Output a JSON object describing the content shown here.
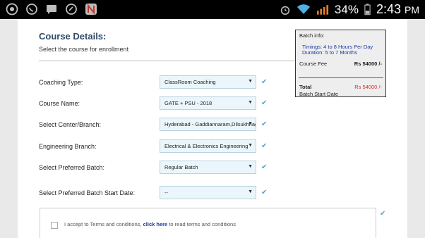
{
  "status_bar": {
    "icons_left": [
      "chrome-icon",
      "whatsapp-icon",
      "message-icon",
      "phone-icon",
      "netflix-icon"
    ],
    "battery": "34%",
    "time": "2:43",
    "time_suffix": "PM"
  },
  "course": {
    "title": "Course Details:",
    "subtitle": "Select the course for enrollment"
  },
  "batch_info": {
    "title": "Batch info:",
    "timings": "Timings: 4 to 8 Hours Per Day",
    "duration": "Duration: 5 to 7 Months",
    "fee_label": "Course Fee",
    "fee_value": "Rs 54000 /-",
    "total_label": "Total",
    "total_value": "Rs 54000 /-",
    "start_label": "Batch Start Date"
  },
  "form": {
    "rows": [
      {
        "label": "Coaching Type:",
        "value": "ClassRoom Coaching"
      },
      {
        "label": "Course Name:",
        "value": "GATE + PSU - 2018"
      },
      {
        "label": "Select Center/Branch:",
        "value": "Hyderabad - Gaddiannaram,Dilsukhnagar"
      },
      {
        "label": "Engineering Branch:",
        "value": "Electrical & Electronics Engineering"
      },
      {
        "label": "Select Preferred Batch:",
        "value": "Regular Batch"
      },
      {
        "label": "Select Preferred Batch Start Date:",
        "value": "--"
      }
    ]
  },
  "terms": {
    "text_before": "I accept to Terms and conditions,",
    "link": "click here",
    "text_after": "to read terms and conditions"
  },
  "colors": {
    "heading": "#2f4a6a",
    "select_bg": "#eaf6fb",
    "check": "#55a3c9",
    "total_red": "#cc3333"
  }
}
